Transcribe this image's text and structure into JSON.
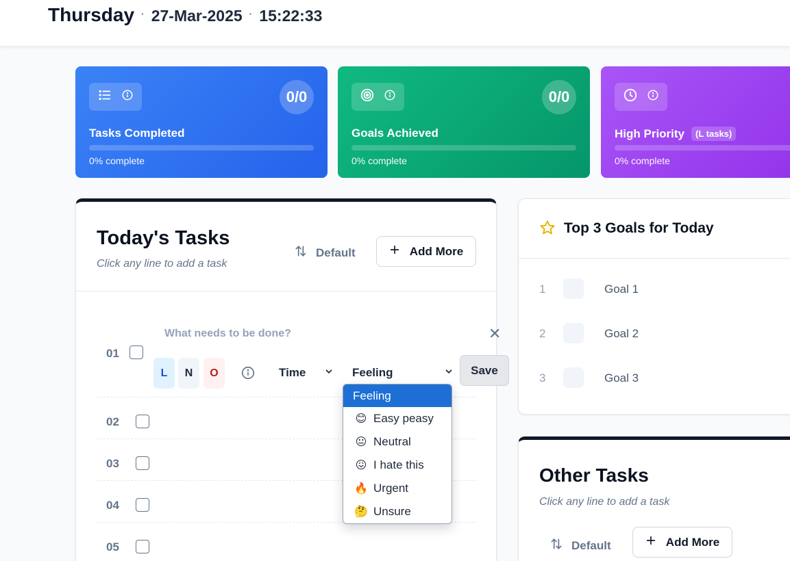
{
  "header": {
    "day": "Thursday",
    "date": "27-Mar-2025",
    "time": "15:22:33",
    "separator": "·"
  },
  "stats": [
    {
      "label": "Tasks Completed",
      "count": "0/0",
      "progress_label": "0% complete",
      "progress": 0,
      "icon": "list-icon",
      "color": "#3b82f6"
    },
    {
      "label": "Goals Achieved",
      "count": "0/0",
      "progress_label": "0% complete",
      "progress": 0,
      "icon": "target-icon",
      "color": "#10b981"
    },
    {
      "label": "High Priority",
      "tag": "(L tasks)",
      "progress_label": "0% complete",
      "progress": 0,
      "icon": "clock-icon",
      "color": "#a855f7"
    }
  ],
  "today": {
    "title": "Today's Tasks",
    "subtitle": "Click any line to add a task",
    "sort_label": "Default",
    "add_label": "Add More",
    "editor": {
      "row_number": "01",
      "placeholder": "What needs to be done?",
      "lno": [
        "L",
        "N",
        "O"
      ],
      "time_label": "Time",
      "feeling_label": "Feeling",
      "save_label": "Save"
    },
    "rows": [
      "02",
      "03",
      "04",
      "05"
    ]
  },
  "feeling_dropdown": {
    "options": [
      {
        "label": "Feeling",
        "emoji": ""
      },
      {
        "label": "Easy peasy",
        "emoji": "😊"
      },
      {
        "label": "Neutral",
        "emoji": "😐"
      },
      {
        "label": "I hate this",
        "emoji": "😖"
      },
      {
        "label": "Urgent",
        "emoji": "🔥"
      },
      {
        "label": "Unsure",
        "emoji": "🤔"
      }
    ],
    "highlighted": "Feeling"
  },
  "goals": {
    "title": "Top 3 Goals for Today",
    "items": [
      {
        "num": "1",
        "label": "Goal 1"
      },
      {
        "num": "2",
        "label": "Goal 2"
      },
      {
        "num": "3",
        "label": "Goal 3"
      }
    ]
  },
  "other": {
    "title": "Other Tasks",
    "subtitle": "Click any line to add a task",
    "sort_label": "Default",
    "add_label": "Add More"
  }
}
